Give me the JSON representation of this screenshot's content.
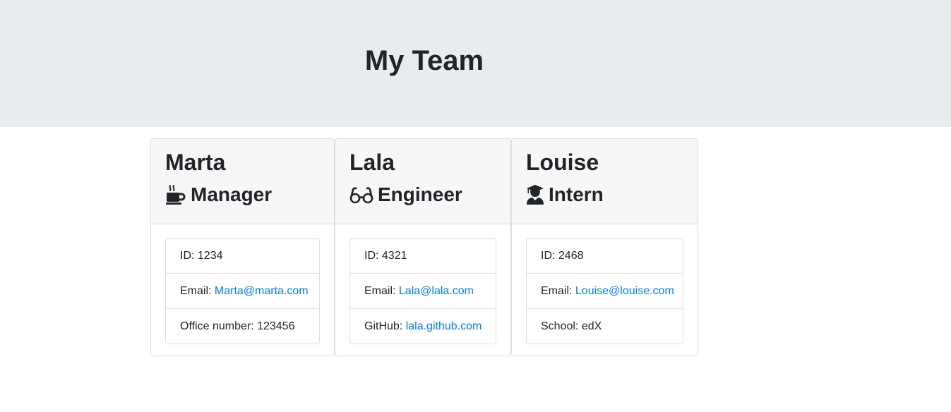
{
  "header": {
    "title": "My Team"
  },
  "team": [
    {
      "name": "Marta",
      "role": "Manager",
      "role_icon": "mug-hot-icon",
      "id_label": "ID: 1234",
      "email_prefix": "Email: ",
      "email": "Marta@marta.com",
      "extra_prefix": "Office number: 123456",
      "extra_link": ""
    },
    {
      "name": "Lala",
      "role": "Engineer",
      "role_icon": "glasses-icon",
      "id_label": "ID: 4321",
      "email_prefix": "Email: ",
      "email": "Lala@lala.com",
      "extra_prefix": "GitHub: ",
      "extra_link": "lala.github.com"
    },
    {
      "name": "Louise",
      "role": "Intern",
      "role_icon": "user-graduate-icon",
      "id_label": "ID: 2468",
      "email_prefix": "Email: ",
      "email": "Louise@louise.com",
      "extra_prefix": "School: edX",
      "extra_link": ""
    }
  ],
  "colors": {
    "header_bg": "#e9ecef",
    "card_header_bg": "#f7f7f7",
    "link": "#007bff",
    "text": "#212529"
  }
}
